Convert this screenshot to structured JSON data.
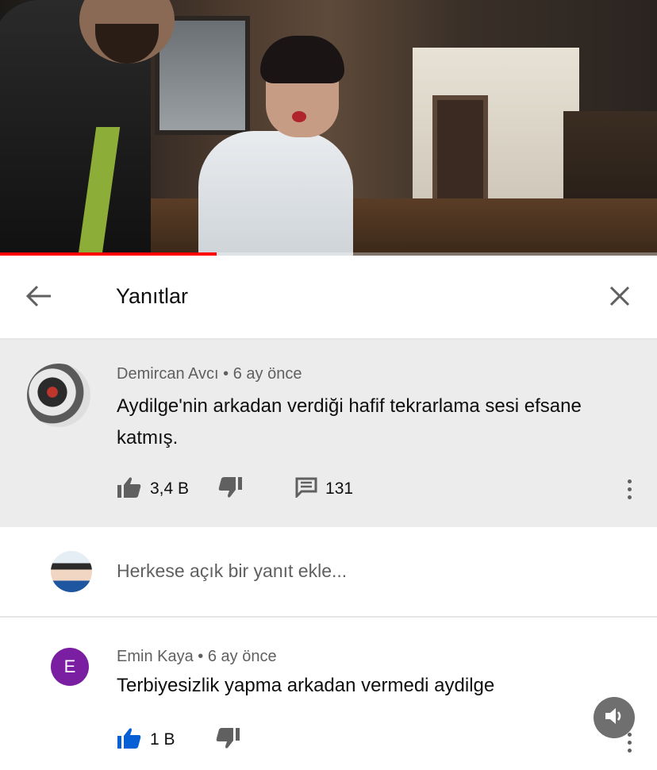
{
  "video": {
    "progress_percent": 33
  },
  "header": {
    "title": "Yanıtlar",
    "back_icon": "arrow-left-icon",
    "close_icon": "close-icon"
  },
  "parent_comment": {
    "author": "Demircan Avcı",
    "time": "6 ay önce",
    "separator": "•",
    "text": "Aydilge'nin arkadan verdiği hafif tekrarlama sesi efsane katmış.",
    "likes": "3,4 B",
    "replies": "131",
    "icons": {
      "like": "thumb-up-icon",
      "dislike": "thumb-down-icon",
      "reply": "comment-icon",
      "more": "more-vertical-icon"
    }
  },
  "add_reply": {
    "placeholder": "Herkese açık bir yanıt ekle..."
  },
  "reply": {
    "avatar_letter": "E",
    "avatar_color": "#7b1fa2",
    "author": "Emin Kaya",
    "time": "6 ay önce",
    "separator": "•",
    "text": "Terbiyesizlik yapma arkadan vermedi aydilge",
    "likes": "1 B",
    "like_active_color": "#065fd4"
  },
  "mute_icon": "speaker-icon"
}
